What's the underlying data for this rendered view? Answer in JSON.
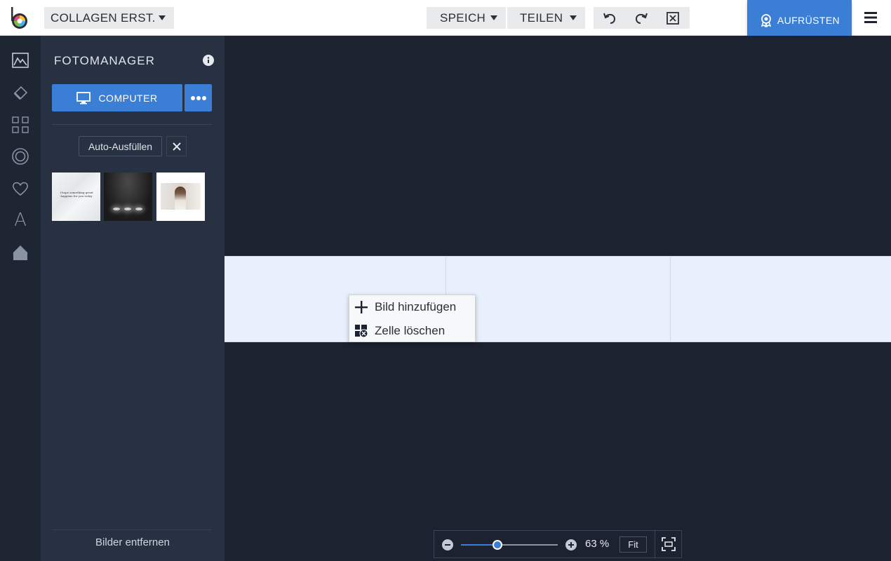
{
  "topbar": {
    "collage_menu_label": "COLLAGEN ERST.",
    "save_label": "SPEICH",
    "share_label": "TEILEN",
    "upgrade_label": "AUFRÜSTEN",
    "accent_color": "#3a7fd5"
  },
  "rail": {
    "items": [
      "adjust-icon",
      "eraser-icon",
      "grid-layout-icon",
      "frame-circle-icon",
      "heart-icon",
      "text-icon",
      "shape-icon"
    ],
    "text_glyph": "A"
  },
  "panel": {
    "title": "FOTOMANAGER",
    "computer_button_label": "COMPUTER",
    "autofill_label": "Auto-Ausfüllen",
    "thumb1_text": "I hope something great happens for you today",
    "remove_images_label": "Bilder entfernen"
  },
  "context_menu": {
    "items": [
      {
        "label": "Bild hinzufügen",
        "icon": "plus-icon"
      },
      {
        "label": "Zelle löschen",
        "icon": "delete-cell-icon"
      }
    ]
  },
  "zoom": {
    "percent_label": "63 %",
    "level": 0.38,
    "fit_label": "Fit"
  }
}
